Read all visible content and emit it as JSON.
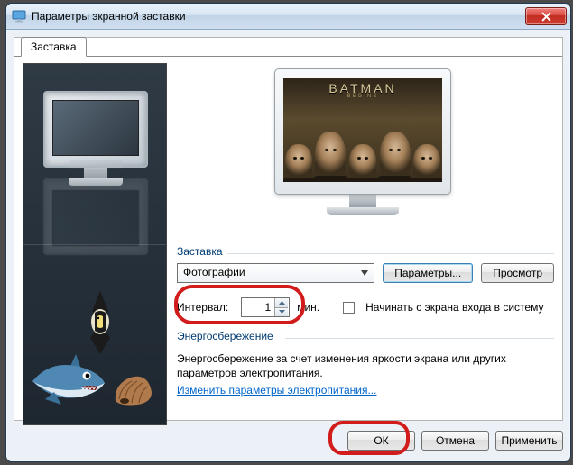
{
  "window": {
    "title": "Параметры экранной заставки"
  },
  "tab": {
    "label": "Заставка"
  },
  "preview": {
    "movie_title": "BATMAN",
    "movie_subtitle": "BEGINS"
  },
  "group1": {
    "label": "Заставка"
  },
  "screensaver_select": {
    "value": "Фотографии"
  },
  "settings_btn": {
    "label": "Параметры..."
  },
  "preview_btn": {
    "label": "Просмотр"
  },
  "interval": {
    "label": "Интервал:",
    "value": "1",
    "unit": "мин."
  },
  "resume_chk": {
    "label": "Начинать с экрана входа в систему"
  },
  "group2": {
    "label": "Энергосбережение"
  },
  "energy": {
    "text": "Энергосбережение за счет изменения яркости экрана или других параметров электропитания.",
    "link": "Изменить параметры электропитания..."
  },
  "buttons": {
    "ok": "ОК",
    "cancel": "Отмена",
    "apply": "Применить"
  }
}
